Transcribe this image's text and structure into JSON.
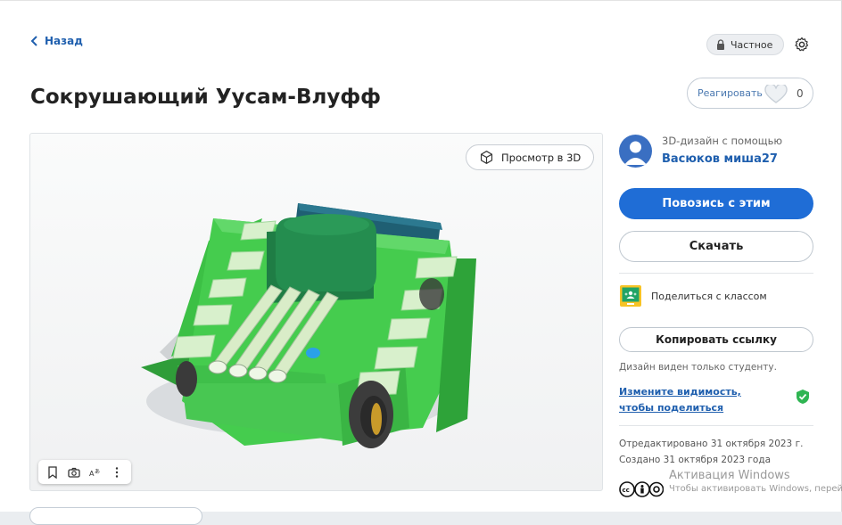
{
  "nav": {
    "back_label": "Назад"
  },
  "privacy": {
    "label": "Частное"
  },
  "design": {
    "title": "Сокрушающий Уусам-Влуфф"
  },
  "reactions": {
    "label": "Реагировать",
    "count": "0"
  },
  "viewer": {
    "view3d_label": "Просмотр в 3D"
  },
  "author": {
    "made_with": "3D-дизайн с помощью",
    "name": "Васюков миша27"
  },
  "actions": {
    "tinker_label": "Повозись с этим",
    "download_label": "Скачать",
    "share_class_label": "Поделиться с классом",
    "copy_link_label": "Копировать ссылку",
    "visibility_note": "Дизайн виден только студенту.",
    "change_visibility_label": "Измените видимость, чтобы поделиться"
  },
  "meta": {
    "edited": "Отредактировано 31 октября 2023 г.",
    "created": "Создано 31 октября 2023 года"
  },
  "watermark": {
    "line1": "Активация Windows",
    "line2": "Чтобы активировать Windows, перейдите"
  },
  "colors": {
    "accent": "#1f6dd6",
    "link": "#1f5fae",
    "model_green": "#3fbf4a",
    "turret_green": "#1f7d45"
  }
}
